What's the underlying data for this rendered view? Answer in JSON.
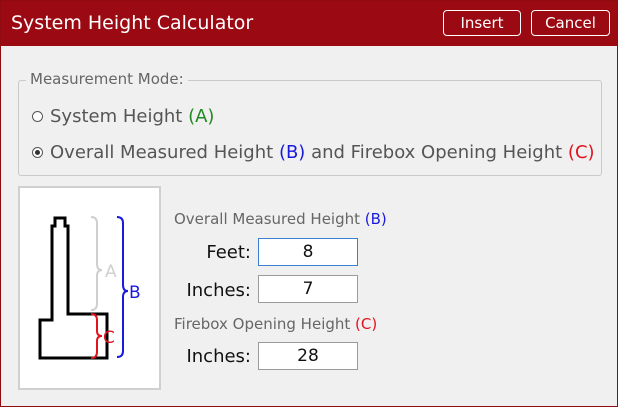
{
  "window": {
    "title": "System Height Calculator",
    "insert_label": "Insert",
    "cancel_label": "Cancel"
  },
  "mode": {
    "legend": "Measurement Mode:",
    "options": [
      {
        "label": "System Height",
        "tag": "(A)",
        "selected": false
      },
      {
        "label_a": "Overall Measured Height",
        "tag_b": "(B)",
        "label_mid": "and Firebox Opening Height",
        "tag_c": "(C)",
        "selected": true
      }
    ]
  },
  "diagram": {
    "label_a": "A",
    "label_b": "B",
    "label_c": "C"
  },
  "overall": {
    "heading": "Overall Measured Height",
    "heading_tag": "(B)",
    "feet_label": "Feet:",
    "feet_value": "8",
    "inches_label": "Inches:",
    "inches_value": "7"
  },
  "firebox": {
    "heading": "Firebox Opening Height",
    "heading_tag": "(C)",
    "inches_label": "Inches:",
    "inches_value": "28"
  },
  "colors": {
    "titlebar": "#9b0a12",
    "blue": "#1a1adc",
    "red": "#e0141e",
    "green": "#1f8a1f"
  }
}
